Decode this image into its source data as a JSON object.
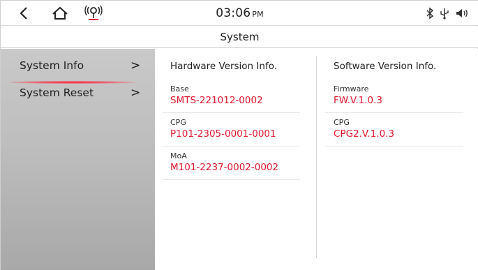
{
  "status_bar": {
    "time": "03:06",
    "ampm": "PM",
    "icons": [
      "back-icon",
      "home-icon",
      "location-signal-icon",
      "bluetooth-icon",
      "usb-icon",
      "volume-icon"
    ]
  },
  "title": "System",
  "sidebar": {
    "items": [
      {
        "label": "System Info",
        "chevron": ">",
        "active": true
      },
      {
        "label": "System Reset",
        "chevron": ">",
        "active": false
      }
    ]
  },
  "hardware": {
    "heading": "Hardware Version Info.",
    "entries": [
      {
        "key": "Base",
        "value": "SMTS-221012-0002"
      },
      {
        "key": "CPG",
        "value": "P101-2305-0001-0001"
      },
      {
        "key": "MoA",
        "value": "M101-2237-0002-0002"
      }
    ]
  },
  "software": {
    "heading": "Software Version Info.",
    "entries": [
      {
        "key": "Firmware",
        "value": "FW.V.1.0.3"
      },
      {
        "key": "CPG",
        "value": "CPG2.V.1.0.3"
      }
    ]
  },
  "colors": {
    "accent": "#e0182d",
    "sidebar": "#bdbdbd"
  }
}
